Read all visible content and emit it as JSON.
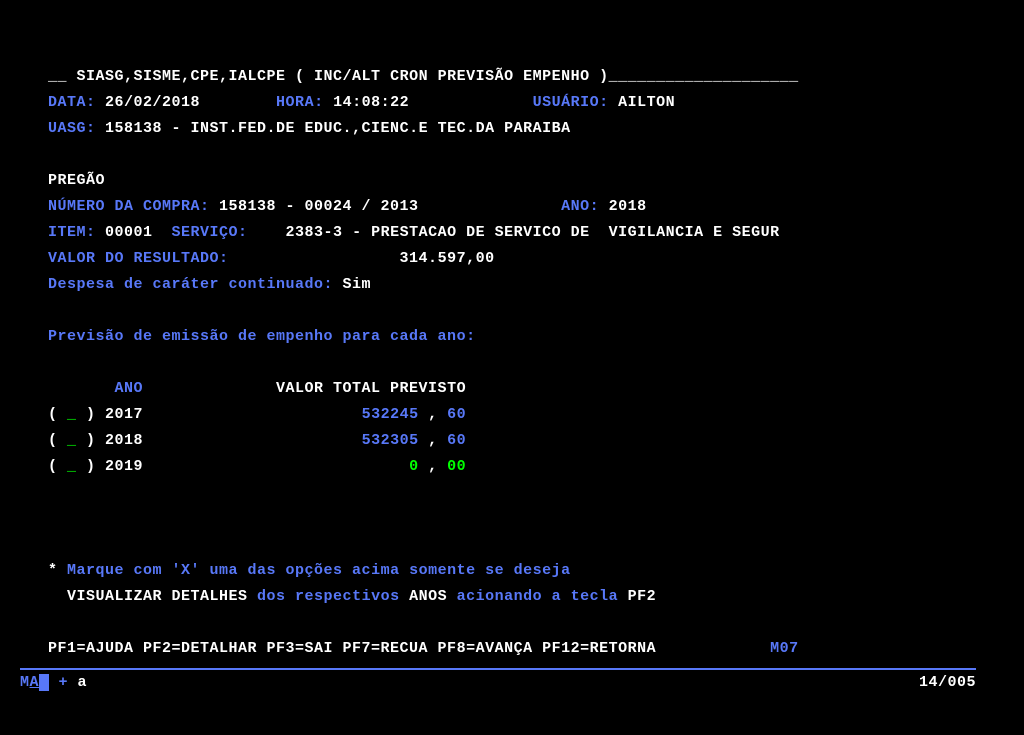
{
  "header": {
    "prefix": "__ ",
    "path": "SIASG,SISME,CPE,IALCPE ( INC/ALT CRON PREVISÃO EMPENHO )",
    "suffix": "____________________"
  },
  "info": {
    "data_lbl": "DATA:",
    "data_val": " 26/02/2018",
    "hora_lbl": "        HORA:",
    "hora_val": " 14:08:22",
    "usuario_lbl": "             USUÁRIO:",
    "usuario_val": " AILTON",
    "uasg_lbl": "UASG:",
    "uasg_val": " 158138 - INST.FED.DE EDUC.,CIENC.E TEC.DA PARAIBA"
  },
  "section": {
    "pregao": "PREGÃO",
    "numcompra_lbl": "NÚMERO DA COMPRA:",
    "numcompra_val": " 158138 - 00024 / 2013",
    "ano_lbl": "               ANO:",
    "ano_val": " 2018",
    "item_lbl": "ITEM:",
    "item_val": " 00001",
    "servico_lbl": "  SERVIÇO:",
    "servico_val": "    2383-3 - PRESTACAO DE SERVICO DE  VIGILANCIA E SEGUR",
    "valor_lbl": "VALOR DO RESULTADO:",
    "valor_val": "                  314.597,00",
    "despesa_lbl": "Despesa de caráter continuado:",
    "despesa_val": " Sim"
  },
  "previsao": {
    "title": "Previsão de emissão de empenho para cada ano:",
    "hdr_ano": "       ANO",
    "hdr_valor": "              VALOR TOTAL PREVISTO",
    "rows": [
      {
        "p1": "( ",
        "mark": "_",
        "p2": " ) 2017",
        "val": "                       532245",
        "comma": " , ",
        "cents": "60"
      },
      {
        "p1": "( ",
        "mark": "_",
        "p2": " ) 2018",
        "val": "                       532305",
        "comma": " , ",
        "cents": "60"
      },
      {
        "p1": "( ",
        "mark": "_",
        "p2": " ) 2019",
        "val": "                            0",
        "comma": " , ",
        "cents": "00"
      }
    ]
  },
  "hint": {
    "star": "* ",
    "l1a": "Marque com 'X' uma das opções acima somente se deseja",
    "l2a_pre": "  ",
    "l2a": "VISUALIZAR DETALHES",
    "l2b": " dos respectivos ",
    "l2c": "ANOS",
    "l2d": " acionando a tecla ",
    "l2e": "PF2"
  },
  "fkeys": {
    "text": "PF1=AJUDA PF2=DETALHAR PF3=SAI PF7=RECUA PF8=AVANÇA PF12=RETORNA",
    "code": "            M07"
  },
  "footer": {
    "left_a": "M",
    "left_b": "A",
    "left_c": " + ",
    "left_d": "a",
    "pos": "14/005"
  }
}
